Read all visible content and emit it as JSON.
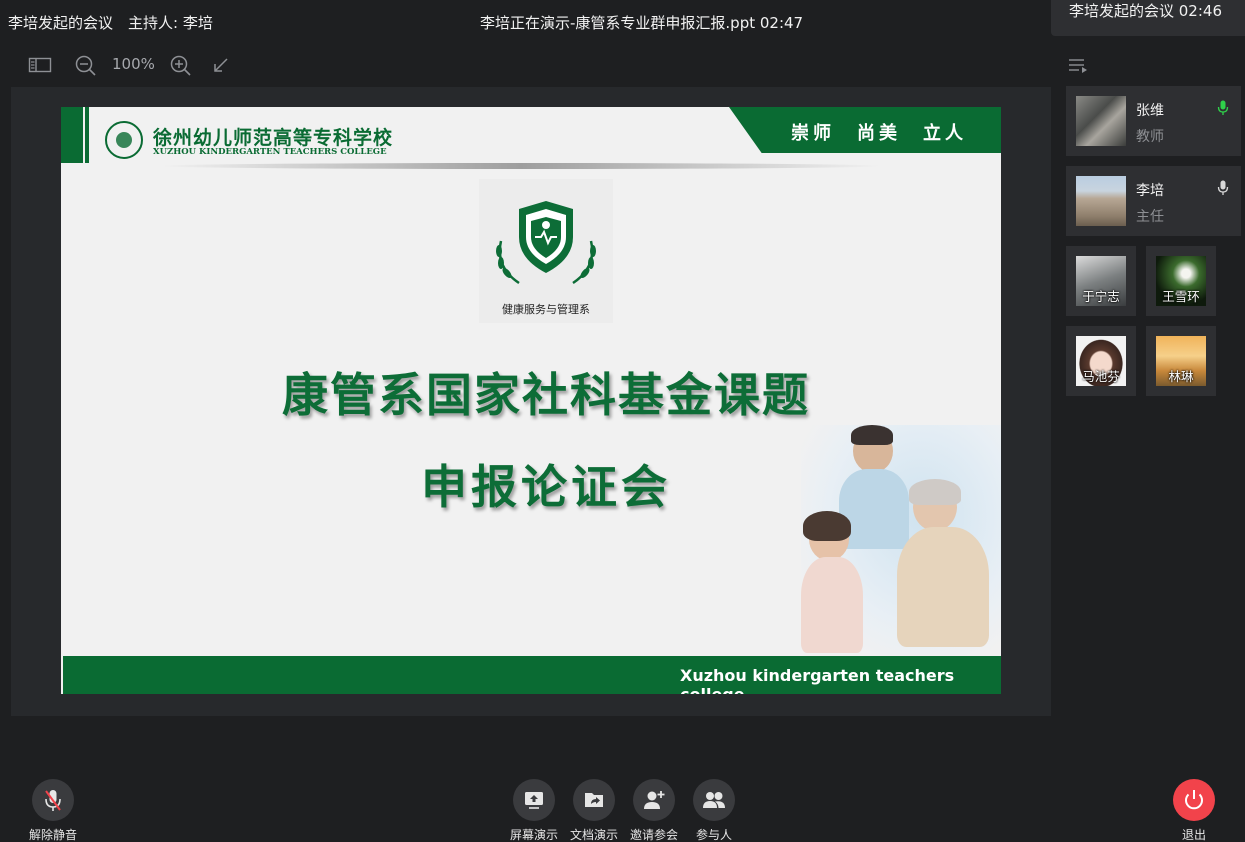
{
  "top": {
    "meeting_title": "李培发起的会议",
    "host_label": "主持人: 李培",
    "presenting": "李培正在演示-康管系专业群申报汇报.ppt 02:47",
    "right_header": "李培发起的会议  02:46"
  },
  "toolbar": {
    "zoom": "100%"
  },
  "slide": {
    "college_cn": "徐州幼儿师范高等专科学校",
    "college_en": "XUZHOU KINDERGARTEN TEACHERS COLLEGE",
    "motto": [
      "崇师",
      "尚美",
      "立人"
    ],
    "dept_name": "健康服务与管理系",
    "title_line1": "康管系国家社科基金课题",
    "title_line2": "申报论证会",
    "footer_text": "Xuzhou kindergarten teachers college"
  },
  "participants": [
    {
      "name": "张维",
      "role": "教师",
      "mic": "active"
    },
    {
      "name": "李培",
      "role": "主任",
      "mic": "idle"
    }
  ],
  "tiles": [
    {
      "name": "于宁志"
    },
    {
      "name": "王雪环"
    },
    {
      "name": "马池芬"
    },
    {
      "name": "林琳"
    }
  ],
  "bottom": {
    "unmute": "解除静音",
    "screen_share": "屏幕演示",
    "doc_share": "文档演示",
    "invite": "邀请参会",
    "participants": "参与人",
    "exit": "退出"
  },
  "colors": {
    "brand_green": "#0a6b33",
    "mic_active": "#2fd14a",
    "exit_red": "#f2434b"
  }
}
